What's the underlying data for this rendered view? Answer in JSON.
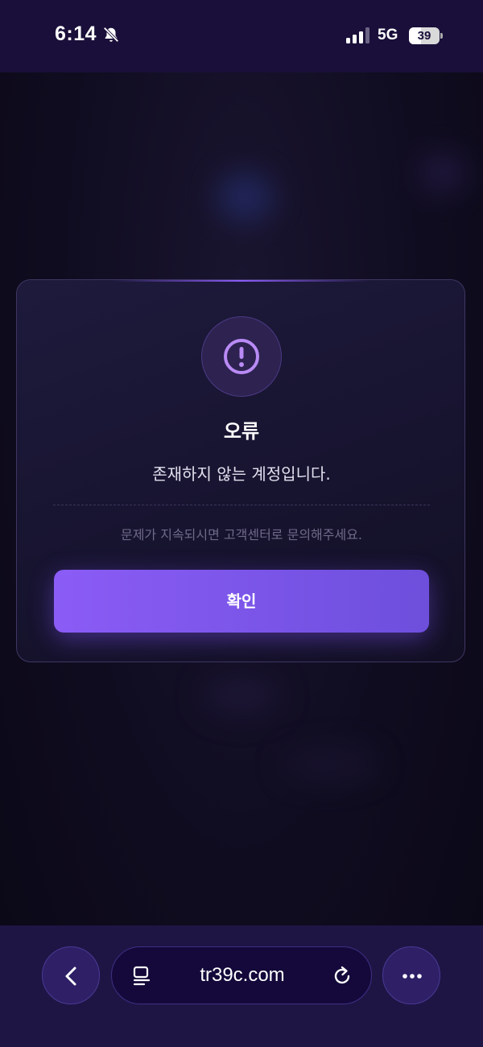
{
  "status_bar": {
    "time": "6:14",
    "network": "5G",
    "battery": "39",
    "battery_level": 0.39,
    "icons": [
      "bell-slash-icon",
      "signal-icon",
      "battery-icon"
    ]
  },
  "dialog": {
    "icon": "exclamation-circle-icon",
    "title": "오류",
    "message": "존재하지 않는 계정입니다.",
    "help_text": "문제가 지속되시면 고객센터로 문의해주세요.",
    "confirm_label": "확인",
    "accent_color": "#8b5cf6"
  },
  "browser_bar": {
    "url": "tr39c.com",
    "icons": [
      "chevron-left-icon",
      "reader-icon",
      "reload-icon",
      "ellipsis-icon"
    ]
  }
}
